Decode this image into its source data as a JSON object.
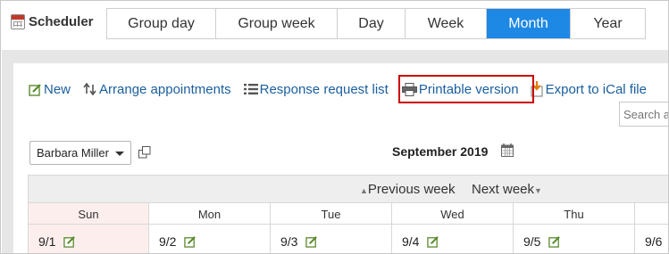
{
  "app": {
    "title": "Scheduler",
    "icon": "calendar-icon"
  },
  "view_tabs": [
    {
      "label": "Group day"
    },
    {
      "label": "Group week"
    },
    {
      "label": "Day"
    },
    {
      "label": "Week"
    },
    {
      "label": "Month",
      "active": true
    },
    {
      "label": "Year"
    }
  ],
  "toolbar": {
    "new_label": "New",
    "arrange_label": "Arrange appointments",
    "response_label": "Response request list",
    "printable_label": "Printable version",
    "ical_label": "Export to iCal file"
  },
  "search": {
    "placeholder": "Search a"
  },
  "user_select": {
    "value": "Barbara Miller"
  },
  "calendar": {
    "month_title": "September 2019",
    "prev_label": "Previous week",
    "next_label": "Next week",
    "days": [
      {
        "name": "Sun",
        "date": "9/1"
      },
      {
        "name": "Mon",
        "date": "9/2"
      },
      {
        "name": "Tue",
        "date": "9/3"
      },
      {
        "name": "Wed",
        "date": "9/4"
      },
      {
        "name": "Thu",
        "date": "9/5"
      },
      {
        "name": "",
        "date": "9/6"
      }
    ]
  },
  "colors": {
    "accent": "#1e88e5",
    "link": "#1a5f9e",
    "highlight": "#cc0000",
    "sunday": "#fdeeee"
  }
}
